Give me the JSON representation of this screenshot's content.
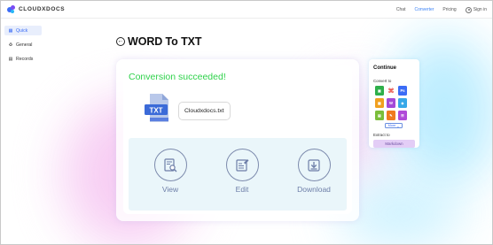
{
  "header": {
    "brand": "CLOUDXDOCS",
    "nav": [
      {
        "label": "Chat",
        "active": false
      },
      {
        "label": "Converter",
        "active": true
      },
      {
        "label": "Pricing",
        "active": false
      }
    ],
    "signin_label": "Sign in"
  },
  "sidebar": {
    "items": [
      {
        "label": "Quick",
        "icon": "grid-icon",
        "active": true
      },
      {
        "label": "General",
        "icon": "recycle-icon",
        "active": false
      },
      {
        "label": "Records",
        "icon": "list-icon",
        "active": false
      }
    ]
  },
  "page": {
    "title": "WORD To TXT"
  },
  "result": {
    "status": "Conversion succeeded!",
    "file_type": "TXT",
    "file_name": "Cloudxdocs.txt",
    "actions": [
      {
        "label": "View",
        "icon": "view-document-icon"
      },
      {
        "label": "Edit",
        "icon": "edit-document-icon"
      },
      {
        "label": "Download",
        "icon": "download-icon"
      }
    ]
  },
  "continue_panel": {
    "title": "Continue",
    "convert_to_label": "Convert to",
    "formats": [
      {
        "icon": "image-format-icon",
        "color": "#2eaf4a"
      },
      {
        "icon": "pdf-format-icon",
        "color": "#e8453c"
      },
      {
        "icon": "ppt-format-icon",
        "color": "#3b6cf6"
      },
      {
        "icon": "excel-format-icon",
        "color": "#f0a020"
      },
      {
        "icon": "word-format-icon",
        "color": "#a34ad8"
      },
      {
        "icon": "html-format-icon",
        "color": "#37a8e8"
      },
      {
        "icon": "spreadsheet-format-icon",
        "color": "#7bbd3a"
      },
      {
        "icon": "markdown-format-icon",
        "color": "#f07a20"
      },
      {
        "icon": "text-format-icon",
        "color": "#b04ad8"
      }
    ],
    "more_label": "More",
    "extract_label": "Extract to",
    "extract_button": "Markdown"
  },
  "colors": {
    "accent": "#3b6cf6",
    "success": "#2fd24b",
    "action_label": "#6d7ea8",
    "txt_icon": "#3b6ad8"
  }
}
